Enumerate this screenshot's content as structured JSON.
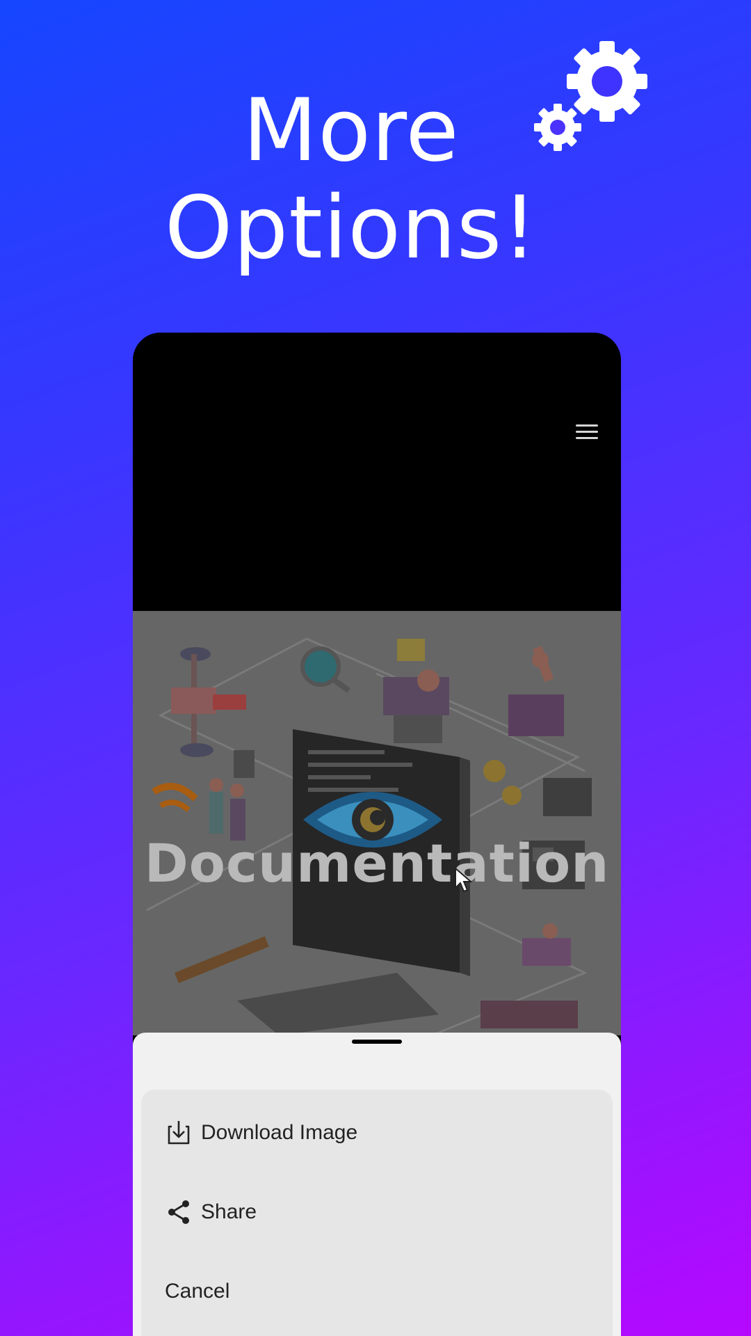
{
  "headline": {
    "line1": "More",
    "line2": "Options!"
  },
  "header_icon": "gears-icon",
  "phone": {
    "menu_icon": "hamburger-menu-icon",
    "hero": {
      "title": "Documentation",
      "logo_icon": "eye-logo-icon"
    },
    "cursor_icon": "mouse-pointer-icon",
    "sheet": {
      "items": [
        {
          "label": "Download Image",
          "icon": "download-icon"
        },
        {
          "label": "Share",
          "icon": "share-icon"
        },
        {
          "label": "Cancel",
          "icon": ""
        }
      ]
    }
  },
  "colors": {
    "background_start": "#1646ff",
    "background_end": "#b608ff",
    "sheet_bg": "#f1f1f1",
    "menu_card_bg": "#e6e6e6",
    "hero_title": "#b9b9b9"
  }
}
